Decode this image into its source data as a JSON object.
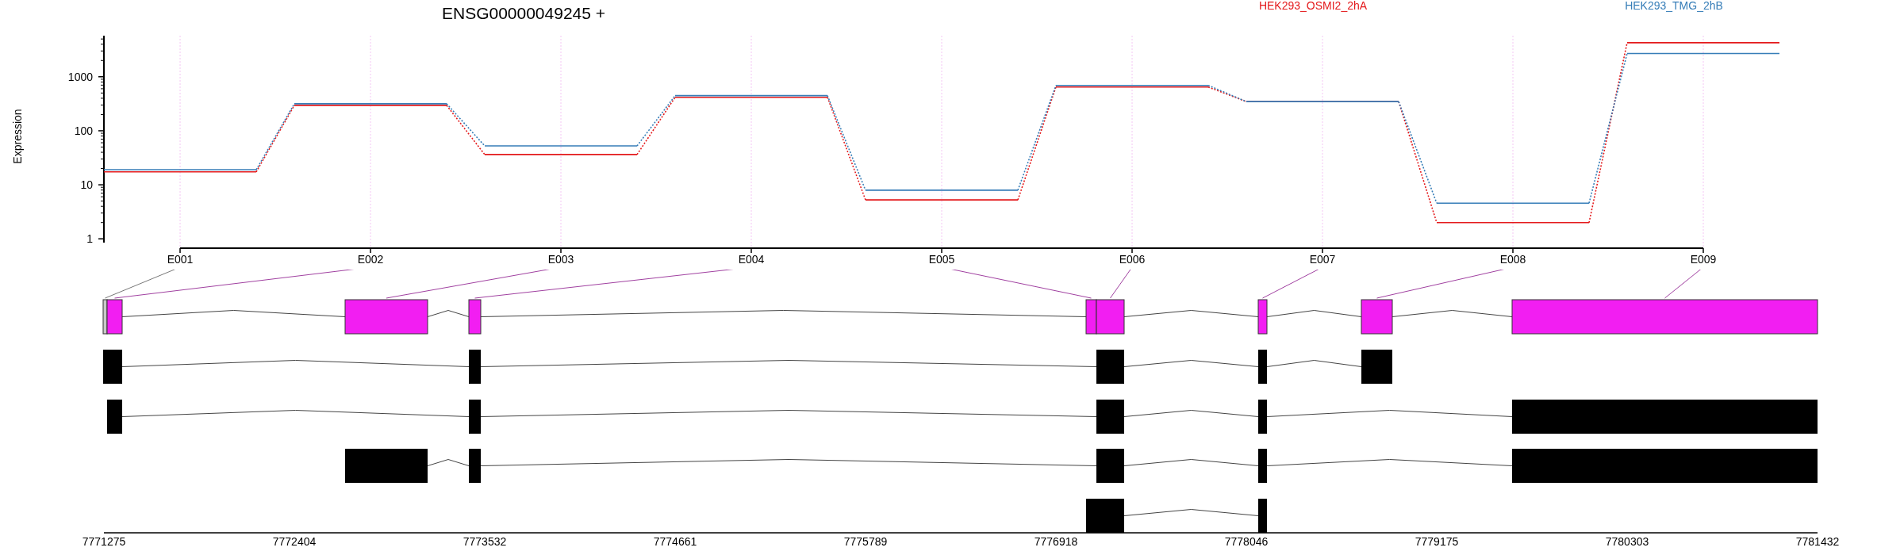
{
  "expression_plot": {
    "title": "ENSG00000049245 +",
    "legend": [
      {
        "name": "HEK293_OSMI2_2hA",
        "color": "#e41a1c"
      },
      {
        "name": "HEK293_TMG_2hB",
        "color": "#377eb8"
      }
    ],
    "y_axis_title": "Expression",
    "y_axis_labels": [
      "1000",
      "100",
      "10",
      "1"
    ],
    "exon_labels": [
      "E001",
      "E002",
      "E003",
      "E004",
      "E005",
      "E006",
      "E007",
      "E008",
      "E009"
    ]
  },
  "gene_model": {
    "axis_labels": [
      "7771275",
      "7772404",
      "7773532",
      "7774661",
      "7775789",
      "7776918",
      "7778046",
      "7779175",
      "7780303",
      "7781432"
    ]
  }
}
